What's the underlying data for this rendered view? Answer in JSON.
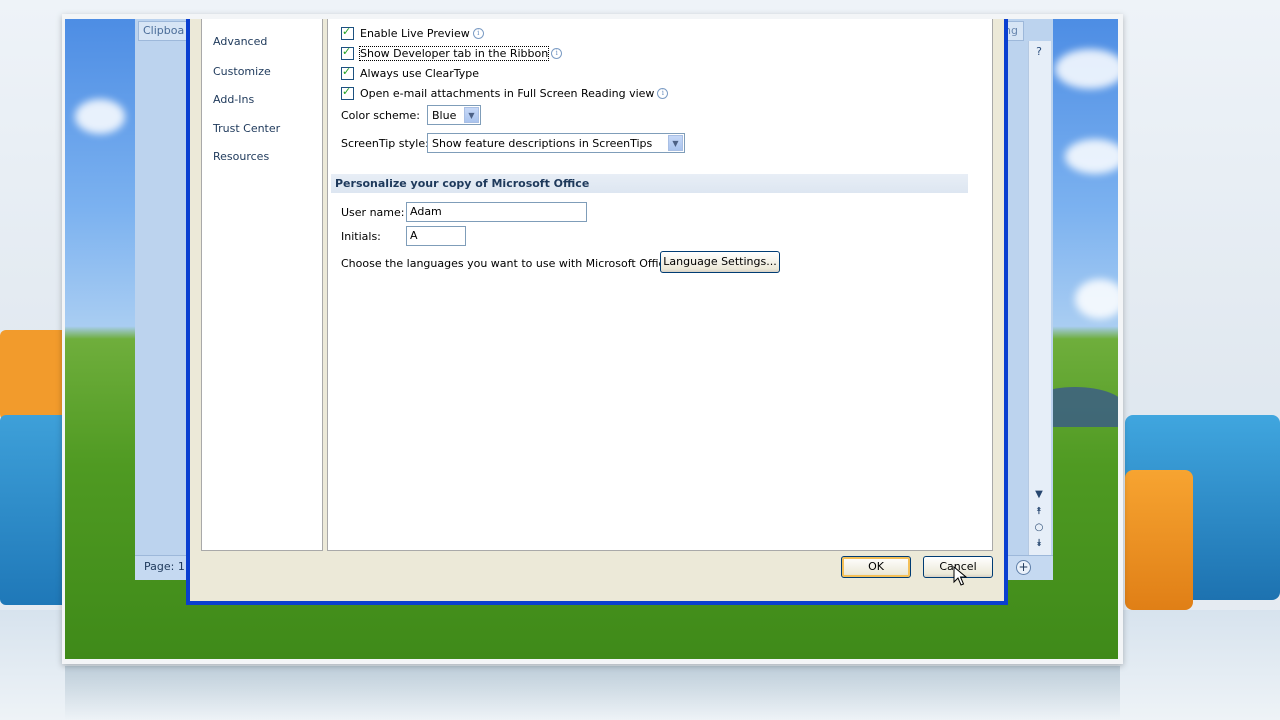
{
  "word_window": {
    "ribbon_tab_left": "Clipboa",
    "ribbon_tab_right": "ing",
    "status_page": "Page: 1"
  },
  "dialog": {
    "nav": {
      "items": [
        {
          "label": "Advanced"
        },
        {
          "label": "Customize"
        },
        {
          "label": "Add-Ins"
        },
        {
          "label": "Trust Center"
        },
        {
          "label": "Resources"
        }
      ]
    },
    "top_options": {
      "enable_live_preview": "Enable Live Preview",
      "show_developer_tab": "Show Developer tab in the Ribbon",
      "always_use_cleartype": "Always use ClearType",
      "open_email_full_screen": "Open e-mail attachments in Full Screen Reading view",
      "color_scheme_label": "Color scheme:",
      "color_scheme_value": "Blue",
      "screentip_label": "ScreenTip style:",
      "screentip_value": "Show feature descriptions in ScreenTips"
    },
    "personalize": {
      "section_title": "Personalize your copy of Microsoft Office",
      "user_name_label": "User name:",
      "user_name_value": "Adam",
      "initials_label": "Initials:",
      "initials_value": "A",
      "languages_text": "Choose the languages you want to use with Microsoft Office:",
      "language_settings_button": "Language Settings..."
    },
    "footer": {
      "ok_label": "OK",
      "cancel_label": "Cancel"
    }
  },
  "icons": {
    "info": "info-icon",
    "checkbox_checked": "checkmark-icon",
    "dropdown_arrow": "chevron-down-icon",
    "help": "help-icon",
    "zoom_in": "plus-icon",
    "mouse_pointer": "cursor-icon"
  },
  "colors": {
    "dialog_border": "#0a3fd0",
    "section_header_text": "#1e395b",
    "ok_focus": "#f4c058"
  }
}
